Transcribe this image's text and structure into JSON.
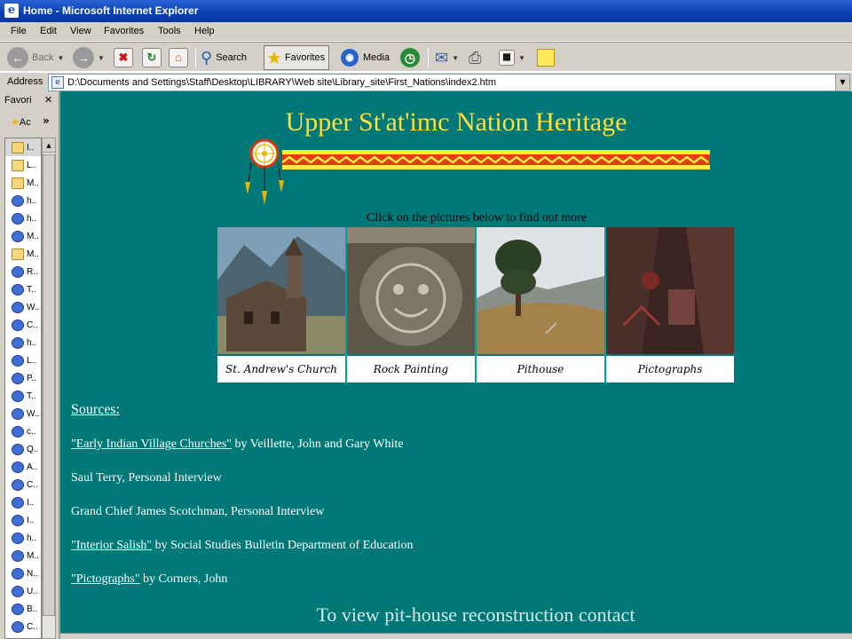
{
  "window": {
    "title": "Home - Microsoft Internet Explorer"
  },
  "menu": [
    "File",
    "Edit",
    "View",
    "Favorites",
    "Tools",
    "Help"
  ],
  "toolbar": {
    "back": "Back",
    "search": "Search",
    "favorites": "Favorites",
    "media": "Media"
  },
  "address": {
    "label": "Address",
    "value": "D:\\Documents and Settings\\Staff\\Desktop\\LIBRARY\\Web site\\Library_site\\First_Nations\\index2.htm"
  },
  "favpane": {
    "title": "Favori",
    "add": "Ac",
    "items": [
      "I..",
      "L..",
      "M..",
      "h..",
      "h..",
      "M..",
      "M..",
      "R..",
      "T..",
      "W..",
      "C..",
      "h..",
      "L..",
      "P..",
      "T..",
      "W..",
      "c..",
      "Q..",
      "A..",
      "C..",
      "I..",
      "I..",
      "h..",
      "M..",
      "N..",
      "U..",
      "B..",
      "C.."
    ]
  },
  "page": {
    "heading": "Upper St'at'imc Nation Heritage",
    "instruction": "Click on the pictures below to find out more",
    "pictures": [
      "St. Andrew's Church",
      "Rock Painting",
      "Pithouse",
      "Pictographs"
    ],
    "sources_heading": "Sources:",
    "sources": [
      {
        "link": "\"Early Indian Village Churches\"",
        "rest": " by Veillette, John and Gary White"
      },
      {
        "link": "",
        "rest": "Saul Terry, Personal Interview"
      },
      {
        "link": "",
        "rest": "Grand Chief James Scotchman, Personal Interview"
      },
      {
        "link": "\"Interior Salish\"",
        "rest": " by Social Studies Bulletin Department of Education"
      },
      {
        "link": "\"Pictographs\"",
        "rest": " by Corners, John"
      }
    ],
    "footer": "To view pit-house reconstruction contact"
  }
}
